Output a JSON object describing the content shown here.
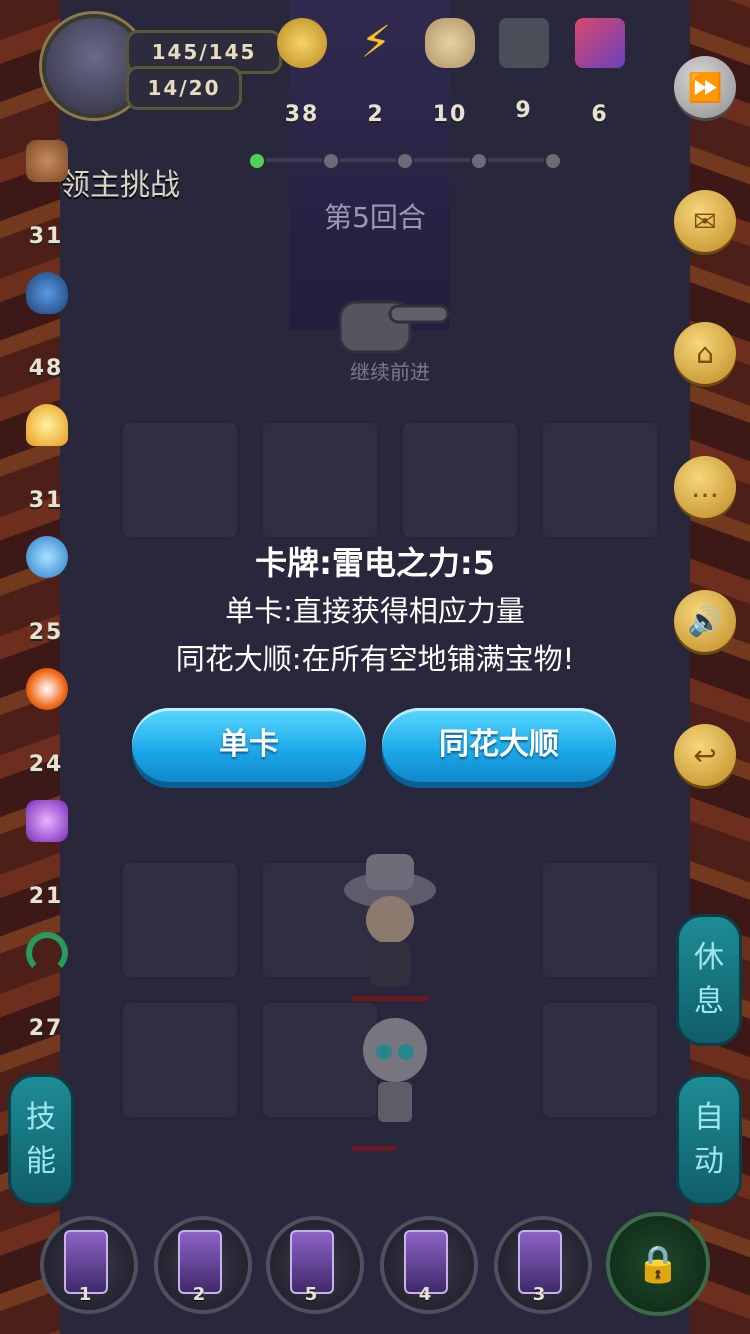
{
  "player": {
    "hp": "145/145",
    "stamina": "14/20"
  },
  "resources": [
    {
      "icon": "gold-coin-icon",
      "value": "38"
    },
    {
      "icon": "lightning-icon",
      "value": "2"
    },
    {
      "icon": "bread-icon",
      "value": "10"
    },
    {
      "icon": "anvil-icon",
      "value": "9"
    },
    {
      "icon": "crystal-icon",
      "value": "6"
    }
  ],
  "stage": {
    "title": "领主挑战",
    "round": "第5回合",
    "continue_label": "继续前进"
  },
  "stats": [
    {
      "icon": "fist-icon",
      "value": "31"
    },
    {
      "icon": "shield-icon",
      "value": "48"
    },
    {
      "icon": "flame-icon",
      "value": "31"
    },
    {
      "icon": "wave-icon",
      "value": "25"
    },
    {
      "icon": "fireball-icon",
      "value": "24"
    },
    {
      "icon": "lightning-bolt-icon",
      "value": "21"
    },
    {
      "icon": "horseshoe-icon",
      "value": "27"
    }
  ],
  "dialog": {
    "title": "卡牌:雷电之力:5",
    "line1": "单卡:直接获得相应力量",
    "line2": "同花大顺:在所有空地铺满宝物!",
    "btn_single": "单卡",
    "btn_flush": "同花大顺"
  },
  "side": {
    "skill": "技\n能",
    "rest": "休\n息",
    "auto": "自\n动"
  },
  "cards": [
    "1",
    "2",
    "5",
    "4",
    "3"
  ],
  "colors": {
    "button": "#1aa7e8",
    "lava": "#b8451c",
    "floor": "#3b3a52"
  }
}
